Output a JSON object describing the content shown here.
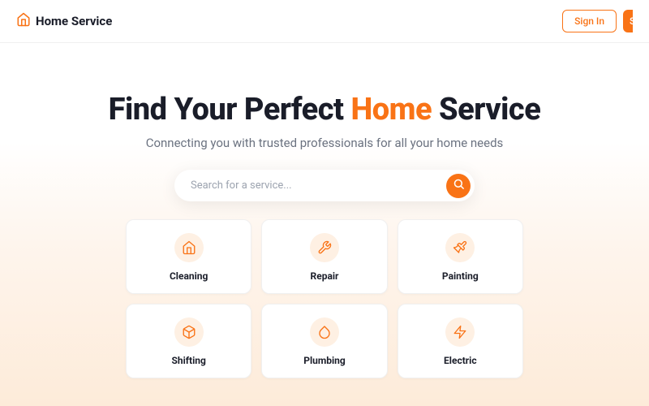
{
  "header": {
    "logo_text": "Home Service",
    "signin_label": "Sign In",
    "signup_label": "S"
  },
  "hero": {
    "title_prefix": "Find Your Perfect ",
    "title_accent": "Home",
    "title_suffix": " Service",
    "subtitle": "Connecting you with trusted professionals for all your home needs"
  },
  "search": {
    "placeholder": "Search for a service..."
  },
  "services": [
    {
      "label": "Cleaning",
      "icon": "home-icon"
    },
    {
      "label": "Repair",
      "icon": "wrench-icon"
    },
    {
      "label": "Painting",
      "icon": "paintbrush-icon"
    },
    {
      "label": "Shifting",
      "icon": "box-icon"
    },
    {
      "label": "Plumbing",
      "icon": "droplet-icon"
    },
    {
      "label": "Electric",
      "icon": "zap-icon"
    }
  ]
}
